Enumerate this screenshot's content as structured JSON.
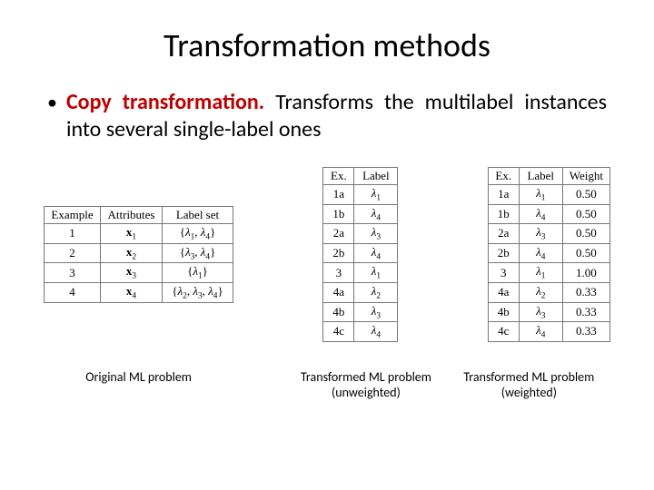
{
  "title": "Transformation methods",
  "bullet": {
    "highlight": "Copy transformation.",
    "rest": " Transforms the multilabel instances into several single-label ones"
  },
  "table1": {
    "headers": [
      "Example",
      "Attributes",
      "Label set"
    ],
    "rows": [
      {
        "ex": "1",
        "attr_sym": "x",
        "attr_sub": "1",
        "labels": [
          "λ₁",
          "λ₄"
        ]
      },
      {
        "ex": "2",
        "attr_sym": "x",
        "attr_sub": "2",
        "labels": [
          "λ₃",
          "λ₄"
        ]
      },
      {
        "ex": "3",
        "attr_sym": "x",
        "attr_sub": "3",
        "labels": [
          "λ₁"
        ]
      },
      {
        "ex": "4",
        "attr_sym": "x",
        "attr_sub": "4",
        "labels": [
          "λ₂",
          "λ₃",
          "λ₄"
        ]
      }
    ]
  },
  "table2": {
    "headers": [
      "Ex.",
      "Label"
    ],
    "rows": [
      {
        "ex": "1a",
        "label": "λ₁"
      },
      {
        "ex": "1b",
        "label": "λ₄"
      },
      {
        "ex": "2a",
        "label": "λ₃"
      },
      {
        "ex": "2b",
        "label": "λ₄"
      },
      {
        "ex": "3",
        "label": "λ₁"
      },
      {
        "ex": "4a",
        "label": "λ₂"
      },
      {
        "ex": "4b",
        "label": "λ₃"
      },
      {
        "ex": "4c",
        "label": "λ₄"
      }
    ]
  },
  "table3": {
    "headers": [
      "Ex.",
      "Label",
      "Weight"
    ],
    "rows": [
      {
        "ex": "1a",
        "label": "λ₁",
        "w": "0.50"
      },
      {
        "ex": "1b",
        "label": "λ₄",
        "w": "0.50"
      },
      {
        "ex": "2a",
        "label": "λ₃",
        "w": "0.50"
      },
      {
        "ex": "2b",
        "label": "λ₄",
        "w": "0.50"
      },
      {
        "ex": "3",
        "label": "λ₁",
        "w": "1.00"
      },
      {
        "ex": "4a",
        "label": "λ₂",
        "w": "0.33"
      },
      {
        "ex": "4b",
        "label": "λ₃",
        "w": "0.33"
      },
      {
        "ex": "4c",
        "label": "λ₄",
        "w": "0.33"
      }
    ]
  },
  "captions": {
    "c1": "Original ML problem",
    "c2": "Transformed ML problem (unweighted)",
    "c3": "Transformed ML problem (weighted)"
  }
}
